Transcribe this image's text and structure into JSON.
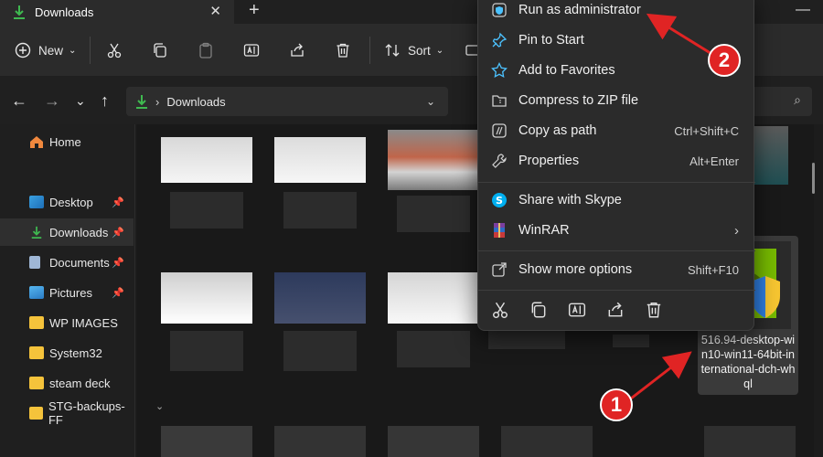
{
  "tab": {
    "title": "Downloads"
  },
  "toolbar": {
    "new_label": "New",
    "sort_label": "Sort"
  },
  "address": {
    "path": "Downloads"
  },
  "sidebar": {
    "items": [
      {
        "label": "Home",
        "pinned": false
      },
      {
        "label": "Desktop",
        "pinned": true
      },
      {
        "label": "Downloads",
        "pinned": true,
        "selected": true
      },
      {
        "label": "Documents",
        "pinned": true
      },
      {
        "label": "Pictures",
        "pinned": true
      },
      {
        "label": "WP IMAGES",
        "pinned": false
      },
      {
        "label": "System32",
        "pinned": false
      },
      {
        "label": "steam deck",
        "pinned": false
      },
      {
        "label": "STG-backups-FF",
        "pinned": false
      }
    ]
  },
  "selected_file": {
    "name": "516.94-desktop-win10-win11-64bit-international-dch-whql"
  },
  "context_menu": {
    "items": [
      {
        "label": "Run as administrator",
        "shortcut": "",
        "icon": "shield-icon"
      },
      {
        "label": "Pin to Start",
        "shortcut": "",
        "icon": "pin-icon"
      },
      {
        "label": "Add to Favorites",
        "shortcut": "",
        "icon": "star-icon"
      },
      {
        "label": "Compress to ZIP file",
        "shortcut": "",
        "icon": "zip-icon"
      },
      {
        "label": "Copy as path",
        "shortcut": "Ctrl+Shift+C",
        "icon": "copy-path-icon"
      },
      {
        "label": "Properties",
        "shortcut": "Alt+Enter",
        "icon": "wrench-icon"
      },
      {
        "label": "Share with Skype",
        "shortcut": "",
        "icon": "skype-icon"
      },
      {
        "label": "WinRAR",
        "shortcut": "",
        "icon": "winrar-icon"
      },
      {
        "label": "Show more options",
        "shortcut": "Shift+F10",
        "icon": "more-options-icon"
      }
    ]
  },
  "annotations": {
    "badge_1": "1",
    "badge_2": "2"
  },
  "colors": {
    "accent": "#4cc2ff",
    "badge": "#e02424",
    "folder": "#f5c33b",
    "download": "#3fb950"
  }
}
